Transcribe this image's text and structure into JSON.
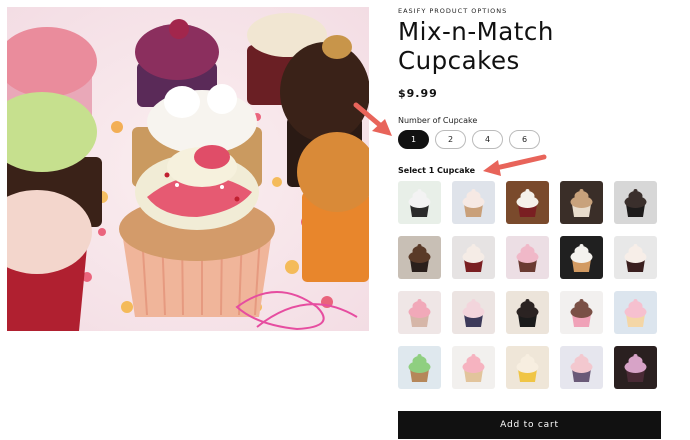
{
  "product": {
    "eyebrow": "EASIFY PRODUCT OPTIONS",
    "title": "Mix-n-Match Cupcakes",
    "price": "$9.99"
  },
  "options": {
    "label": "Number of Cupcake",
    "choices": [
      "1",
      "2",
      "4",
      "6"
    ],
    "selected": "1"
  },
  "selector": {
    "label": "Select 1 Cupcake",
    "thumbnails": [
      {
        "frosting": "#f3f3f3",
        "cake": "#2b2b2b",
        "bg": "#e8efe8"
      },
      {
        "frosting": "#f6e9e4",
        "cake": "#c9a07a",
        "bg": "#dfe3ea"
      },
      {
        "frosting": "#f5f1ea",
        "cake": "#7a1f22",
        "bg": "#7a4a2c"
      },
      {
        "frosting": "#c8a27c",
        "cake": "#e8dccc",
        "bg": "#3a2e28"
      },
      {
        "frosting": "#3a2f2c",
        "cake": "#1d1b1b",
        "bg": "#d7d7d7"
      },
      {
        "frosting": "#5a3a28",
        "cake": "#2a1f1b",
        "bg": "#c8bfb5"
      },
      {
        "frosting": "#f5ece6",
        "cake": "#7a1f22",
        "bg": "#e6e3e3"
      },
      {
        "frosting": "#f0b8c8",
        "cake": "#6b3a32",
        "bg": "#ecdee4"
      },
      {
        "frosting": "#f4f2ee",
        "cake": "#d29a62",
        "bg": "#202020"
      },
      {
        "frosting": "#f7eee8",
        "cake": "#3a1f1f",
        "bg": "#e8e8e8"
      },
      {
        "frosting": "#f1a9b9",
        "cake": "#d6b6a8",
        "bg": "#efe6e6"
      },
      {
        "frosting": "#f3d5dc",
        "cake": "#3d3a5a",
        "bg": "#ece4e2"
      },
      {
        "frosting": "#2b2322",
        "cake": "#1b1b1b",
        "bg": "#ece4da"
      },
      {
        "frosting": "#7a5046",
        "cake": "#f0a2b8",
        "bg": "#f2f0ef"
      },
      {
        "frosting": "#f6c0cf",
        "cake": "#f4d6a6",
        "bg": "#dce5ee"
      },
      {
        "frosting": "#8fcf80",
        "cake": "#b5875a",
        "bg": "#dfe8ee"
      },
      {
        "frosting": "#f6b3c0",
        "cake": "#e2c49c",
        "bg": "#f2f0ee"
      },
      {
        "frosting": "#f7eee0",
        "cake": "#f0c545",
        "bg": "#efe6d8"
      },
      {
        "frosting": "#f3c8cf",
        "cake": "#6a5a78",
        "bg": "#e6e6ee"
      },
      {
        "frosting": "#d7a3c7",
        "cake": "#4a2a35",
        "bg": "#2a2020"
      }
    ]
  },
  "cart": {
    "label": "Add to cart"
  },
  "colors": {
    "arrow": "#e8645a",
    "button": "#111111"
  }
}
